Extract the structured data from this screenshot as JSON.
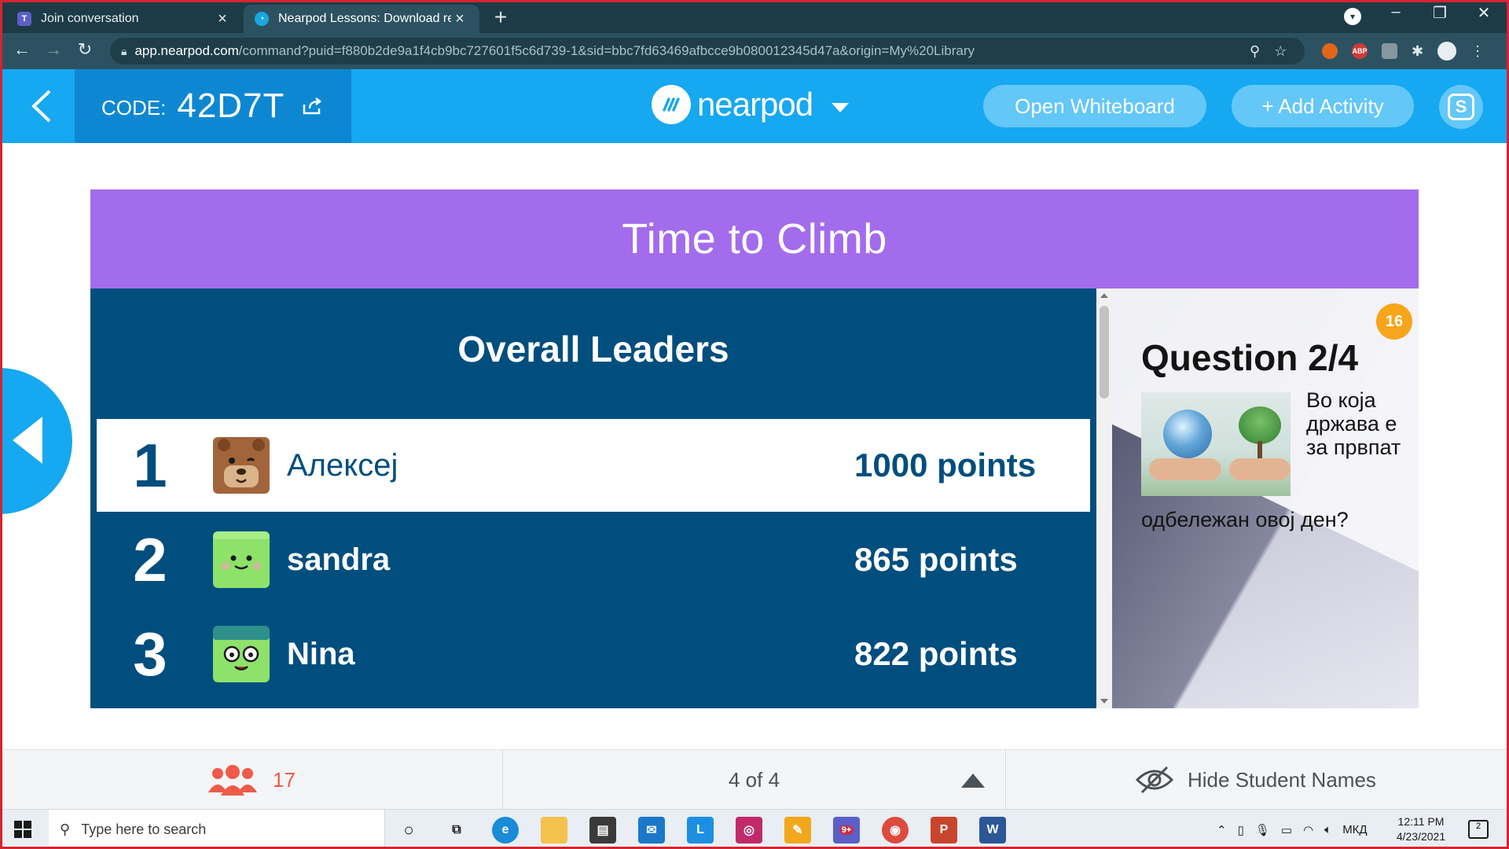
{
  "browser": {
    "tabs": [
      {
        "title": "Join conversation",
        "favicon": "teams-icon"
      },
      {
        "title": "Nearpod Lessons: Download rea",
        "favicon": "nearpod-icon"
      }
    ],
    "url_host": "app.nearpod.com",
    "url_path": "/command?puid=f880b2de9a1f4cb9bc727601f5c6d739-1&sid=bbc7fd63469afbcce9b080012345d47a&origin=My%20Library",
    "ext_abp": "ABP"
  },
  "nearpod": {
    "code_label": "CODE:",
    "code_value": "42D7T",
    "logo_text": "nearpod",
    "whiteboard_button": "Open Whiteboard",
    "add_activity_button": "+ Add Activity",
    "profile_initial": "S",
    "brand_color": "#16a8f0"
  },
  "activity": {
    "title": "Time to Climb",
    "leaders_heading": "Overall Leaders",
    "leaders": [
      {
        "rank": "1",
        "name": "Алексеј",
        "points": "1000 points",
        "avatar": "bear-avatar"
      },
      {
        "rank": "2",
        "name": "sandra",
        "points": "865 points",
        "avatar": "green-cube-avatar"
      },
      {
        "rank": "3",
        "name": "Nina",
        "points": "822 points",
        "avatar": "glasses-avatar"
      }
    ],
    "question": {
      "timer": "16",
      "number": "Question 2/4",
      "text_part1": "Во која држава е за првпат",
      "text_part2": "одбележан овој ден?"
    }
  },
  "footer": {
    "student_count": "17",
    "page_indicator": "4 of 4",
    "hide_names": "Hide Student Names"
  },
  "taskbar": {
    "search_placeholder": "Type here to search",
    "language": "МКД",
    "time": "12:11 PM",
    "date": "4/23/2021",
    "notification_count": "2",
    "teams_badge": "9+"
  }
}
